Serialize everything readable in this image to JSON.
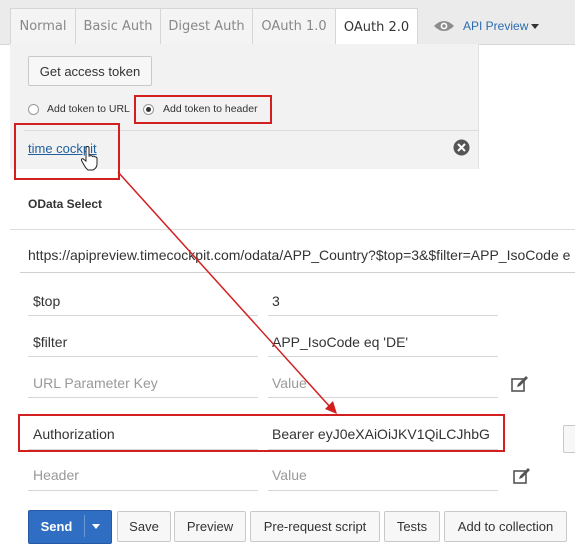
{
  "tabs": [
    "Normal",
    "Basic Auth",
    "Digest Auth",
    "OAuth 1.0",
    "OAuth 2.0"
  ],
  "api_preview": "API Preview",
  "oauth": {
    "get_token_button": "Get access token",
    "radio_url": "Add token to URL",
    "radio_header": "Add token to header",
    "token_link": "time cockpit"
  },
  "odata_select": "OData Select",
  "url": "https://apipreview.timecockpit.com/odata/APP_Country?$top=3&$filter=APP_IsoCode e",
  "url_params": [
    {
      "key": "$top",
      "value": "3"
    },
    {
      "key": "$filter",
      "value": "APP_IsoCode eq 'DE'"
    }
  ],
  "url_param_placeholder": {
    "key": "URL Parameter Key",
    "value": "Value"
  },
  "headers": [
    {
      "key": "Authorization",
      "value": "Bearer eyJ0eXAiOiJKV1QiLCJhbG"
    }
  ],
  "header_placeholder": {
    "key": "Header",
    "value": "Value"
  },
  "actions": {
    "send": "Send",
    "save": "Save",
    "preview": "Preview",
    "prerequest": "Pre-request script",
    "tests": "Tests",
    "add_to_collection": "Add to collection"
  },
  "annotation_color": "#d21f1f"
}
